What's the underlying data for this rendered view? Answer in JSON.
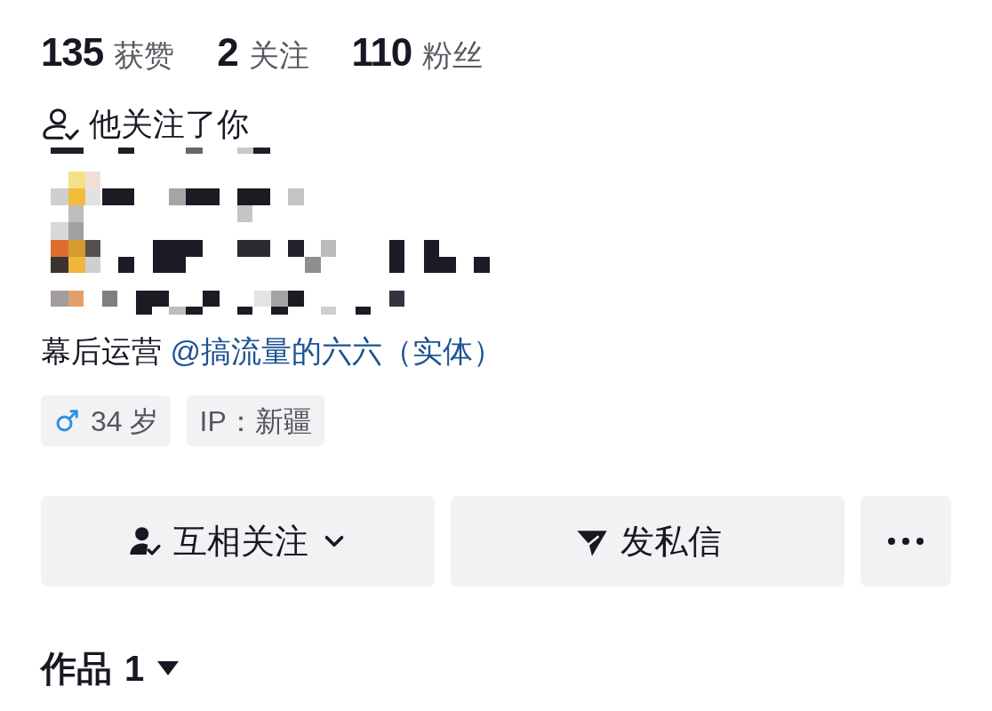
{
  "stats": [
    {
      "count": "135",
      "caption": "获赞"
    },
    {
      "count": "2",
      "caption": "关注"
    },
    {
      "count": "110",
      "caption": "粉丝"
    }
  ],
  "follow_status": "他关注了你",
  "bio": {
    "prefix": "幕后运营",
    "mention": "@搞流量的六六（实体）"
  },
  "tags": [
    {
      "kind": "gender",
      "text": "34 岁"
    },
    {
      "kind": "ip",
      "text": "IP：新疆"
    }
  ],
  "buttons": [
    {
      "kind": "follow",
      "label": "互相关注"
    },
    {
      "kind": "message",
      "label": "发私信"
    },
    {
      "kind": "more"
    }
  ],
  "works_tab": {
    "label": "作品",
    "count": "1"
  }
}
